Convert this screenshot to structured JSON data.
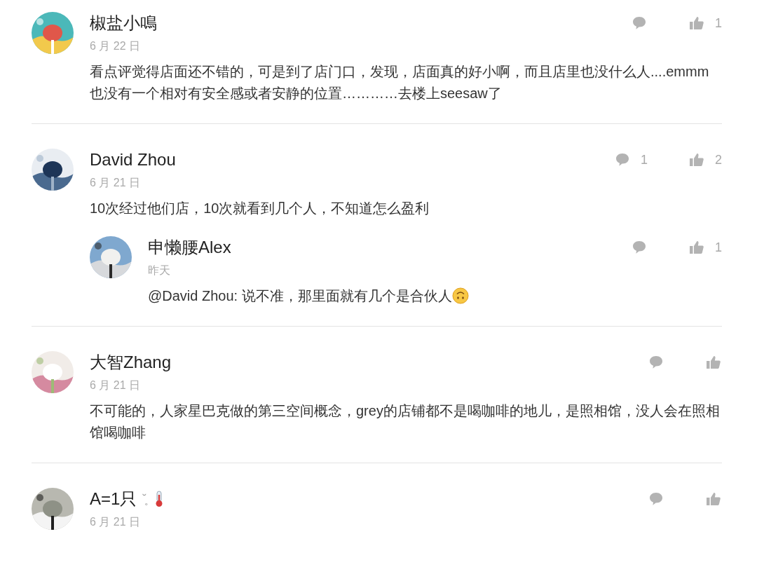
{
  "comments": [
    {
      "author": "椒盐小鳴",
      "date": "6 月 22 日",
      "text": "看点评觉得店面还不错的，可是到了店门口，发现，店面真的好小啊，而且店里也没什么人....emmm也没有一个相对有安全感或者安静的位置…………去楼上seesaw了",
      "likes": "1"
    },
    {
      "author": "David Zhou",
      "date": "6 月 21 日",
      "text": "10次经过他们店，10次就看到几个人，不知道怎么盈利",
      "replies_count": "1",
      "likes": "2",
      "children": [
        {
          "author": "申懒腰Alex",
          "date": "昨天",
          "text": "@David Zhou: 说不准，那里面就有几个是合伙人",
          "emoji": {
            "kind": "upside-down-face"
          },
          "likes": "1"
        }
      ]
    },
    {
      "author": "大智Zhang",
      "date": "6 月 21 日",
      "text": "不可能的，人家星巴克做的第三空间概念，grey的店铺都不是喝咖啡的地儿，是照相馆，没人会在照相馆喝咖啡"
    },
    {
      "author": "A=1只",
      "name_decoration": "˘̥",
      "name_emoji": {
        "kind": "thermometer"
      },
      "date": "6 月 21 日"
    }
  ]
}
